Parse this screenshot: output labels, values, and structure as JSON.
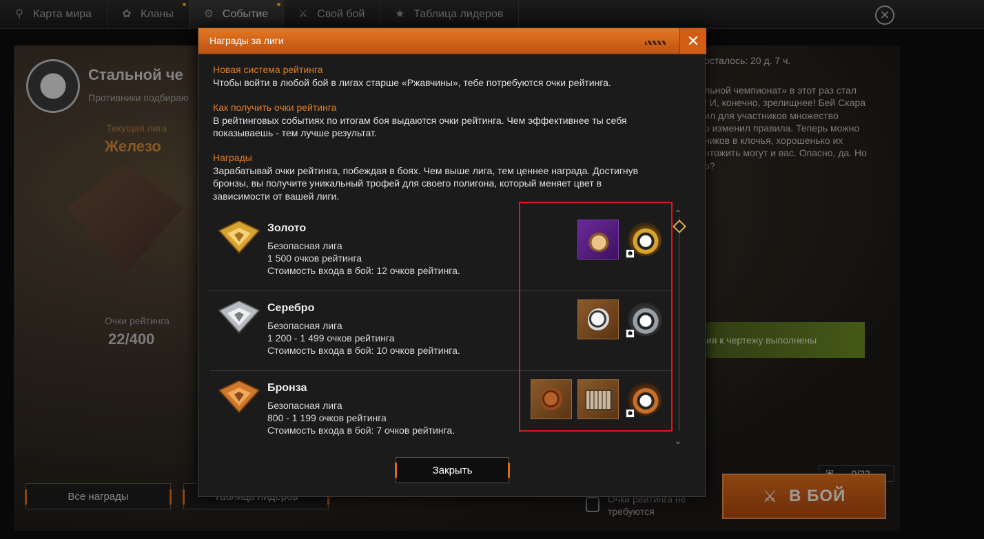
{
  "nav": {
    "tabs": [
      {
        "label": "Карта мира",
        "icon": "map-pin-icon"
      },
      {
        "label": "Кланы",
        "icon": "clan-laurel-icon"
      },
      {
        "label": "Событие",
        "icon": "event-icon"
      },
      {
        "label": "Свой бой",
        "icon": "custom-battle-icon"
      },
      {
        "label": "Таблица лидеров",
        "icon": "leaderboard-icon"
      }
    ],
    "active_tab": "Событие"
  },
  "event": {
    "title": "Стальной че",
    "subtitle": "Противники подбираю",
    "current_league_label": "Текущая лига",
    "current_league": "Железо",
    "rating_label": "Очки рейтинга",
    "rating_value": "22/400",
    "all_rewards": "Все награды",
    "leaderboard": "Таблица лидеров",
    "time_left": "осталось: 20 д. 7 ч.",
    "description_lines": [
      "льной чемпионат» в этот раз стал",
      "! И, конечно, зрелищнее! Бей Скара",
      "ил для участников множество",
      "о изменил правила. Теперь можно",
      "ников в клочья, хорошенько их",
      "нтожить могут и вас. Опасно, да. Но",
      "о?"
    ],
    "blueprint_status": "ия к чертежу выполнены",
    "counter": "0/22",
    "fight_button": "В БОЙ",
    "no_rating_line1": "Очки рейтинга не",
    "no_rating_line2": "требуются"
  },
  "modal": {
    "title": "Награды за лиги",
    "sections": [
      {
        "heading": "Новая система рейтинга",
        "text": "Чтобы войти в любой бой в лигах старше «Ржавчины», тебе потребуются очки рейтинга."
      },
      {
        "heading": "Как получить очки рейтинга",
        "text_lines": [
          "В рейтинговых событиях по итогам боя выдаются очки рейтинга. Чем эффективнее ты себя",
          "показываешь - тем лучше результат."
        ]
      },
      {
        "heading": "Награды",
        "text_lines": [
          "Зарабатывай очки рейтинга, побеждая в боях. Чем выше лига, тем ценнее награда. Достигнув",
          "бронзы, вы получите уникальный трофей для своего полигона, который меняет цвет в",
          "зависимости от вашей лиги."
        ]
      }
    ],
    "leagues": [
      {
        "name": "Золото",
        "safe": "Безопасная лига",
        "points": "1 500 очков рейтинга",
        "cost": "Стоимость входа в бой: 12 очков рейтинга.",
        "color": "#d9a330"
      },
      {
        "name": "Серебро",
        "safe": "Безопасная лига",
        "points": "1 200 - 1 499 очков рейтинга",
        "cost": "Стоимость входа в бой: 10 очков рейтинга.",
        "color": "#b8bcc2"
      },
      {
        "name": "Бронза",
        "safe": "Безопасная лига",
        "points": "800  - 1 199 очков рейтинга",
        "cost": "Стоимость входа в бой: 7 очков рейтинга.",
        "color": "#d0782a"
      }
    ],
    "close_button": "Закрыть"
  },
  "colors": {
    "accent": "#e07d24",
    "highlight_box": "#e01616"
  }
}
